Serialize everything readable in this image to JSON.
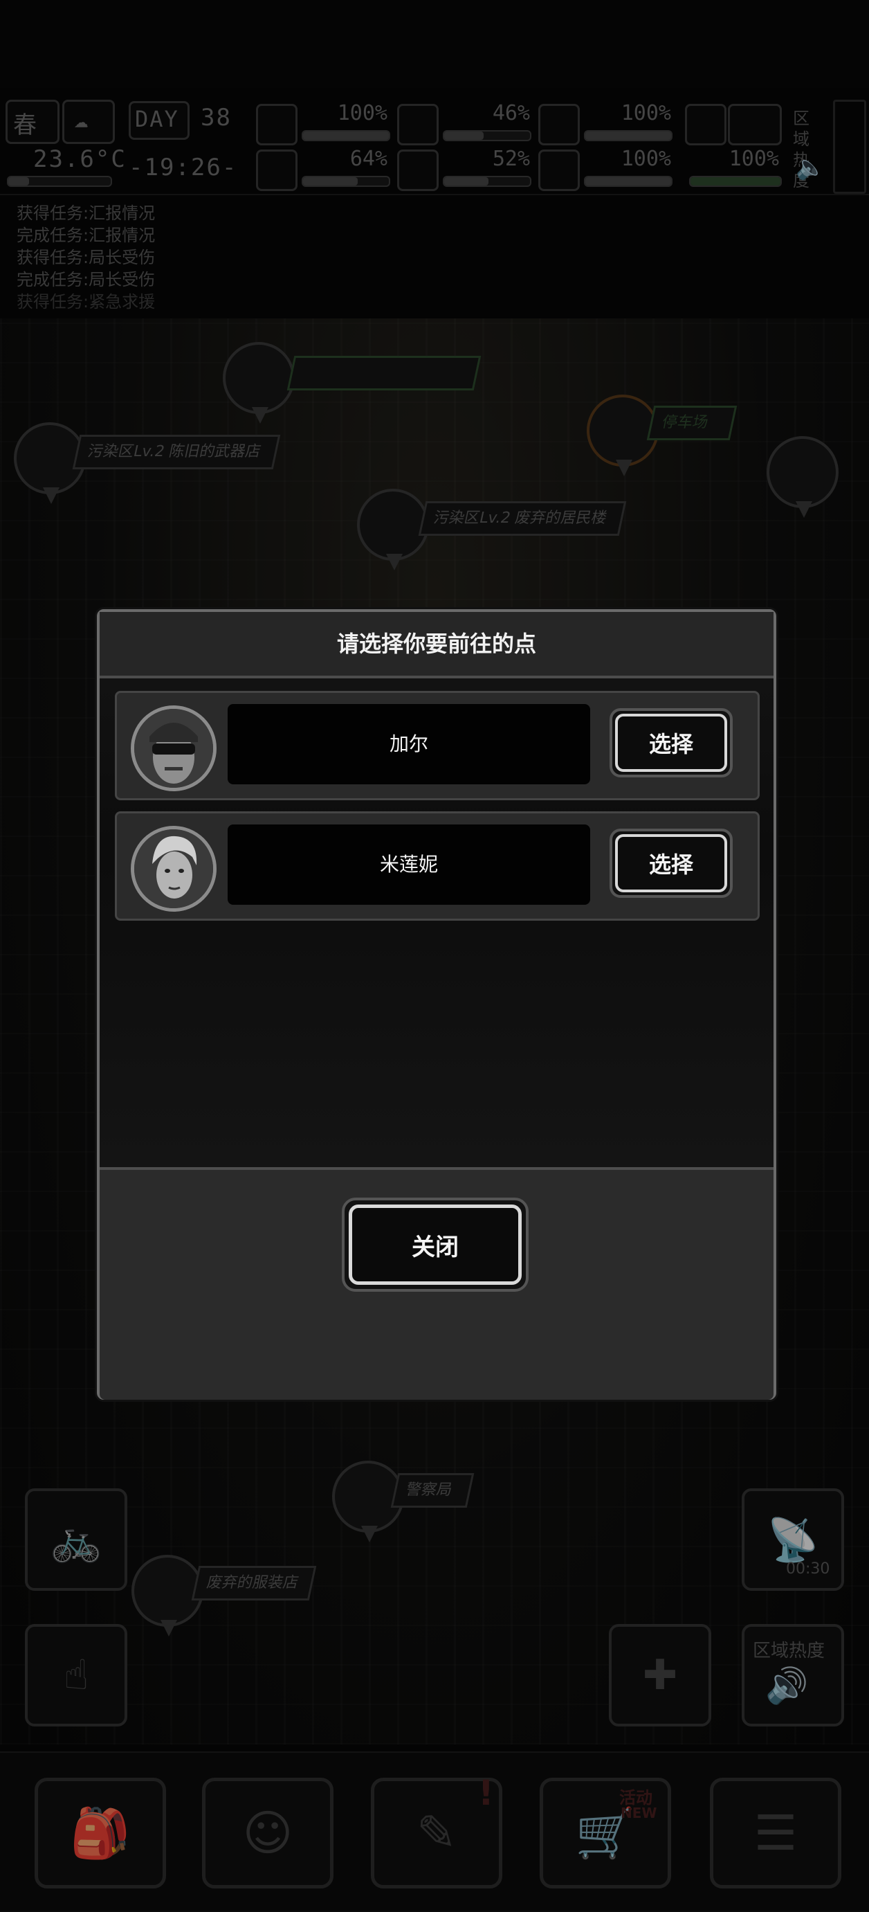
{
  "hud": {
    "season": "春",
    "day_label": "DAY",
    "day": "38",
    "temperature": "23.6°C",
    "clock": "-19:26-",
    "region_heat": "区域热度",
    "stats": [
      {
        "icon": "medkit-icon",
        "value": "100%",
        "level": 1.0
      },
      {
        "icon": "stomach-icon",
        "value": "46%",
        "level": 0.46
      },
      {
        "icon": "pill-icon",
        "value": "100%",
        "level": 1.0
      },
      {
        "icon": "brain-icon",
        "value": "64%",
        "level": 0.64
      },
      {
        "icon": "water-drop-icon",
        "value": "52%",
        "level": 0.52
      },
      {
        "icon": "heart-icon",
        "value": "100%",
        "level": 1.0
      },
      {
        "icon": "stamina-icon",
        "value": "100%",
        "level": 1.0
      }
    ]
  },
  "log": [
    "获得任务:汇报情况",
    "完成任务:汇报情况",
    "获得任务:局长受伤",
    "完成任务:局长受伤",
    "获得任务:紧急求援"
  ],
  "map": {
    "labels": [
      "污染区Lv.2 陈旧的武器店",
      "污染区Lv.2 废弃的居民楼",
      "停车场",
      "警察局",
      "废弃的服装店"
    ],
    "timer": "00:30",
    "region_heat": "区域热度",
    "activity_badge": "活动",
    "new_badge": "NEW"
  },
  "modal": {
    "title": "请选择你要前往的点",
    "options": [
      {
        "name": "加尔",
        "button": "选择"
      },
      {
        "name": "米莲妮",
        "button": "选择"
      }
    ],
    "close": "关闭"
  }
}
